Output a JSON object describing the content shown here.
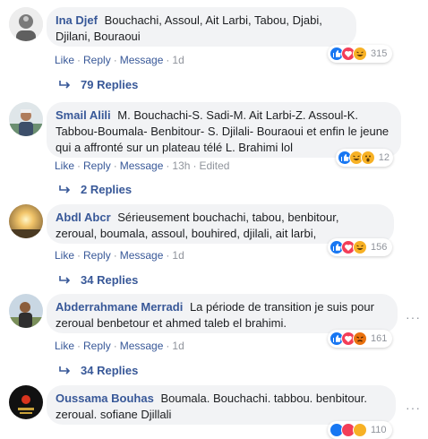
{
  "labels": {
    "like": "Like",
    "reply": "Reply",
    "message": "Message"
  },
  "comments": [
    {
      "author": "Ina Djef",
      "text": "Bouchachi, Assoul, Ait Larbi, Tabou, Djabi, Djilani, Bouraoui",
      "time": "1d",
      "edited": "",
      "reaction_count": "315",
      "reaction_icons": [
        "like-icon",
        "love-icon",
        "haha-icon"
      ],
      "replies": "79 Replies"
    },
    {
      "author": "Smail Alili",
      "text": "M. Bouchachi-S. Sadi-M. Ait Larbi-Z. Assoul-K. Tabbou-Boumala- Benbitour- S. Djilali- Bouraoui et enfin le jeune qui a affronté sur un plateau télé L. Brahimi lol",
      "time": "13h",
      "edited": "Edited",
      "reaction_count": "12",
      "reaction_icons": [
        "like-icon",
        "haha-icon",
        "wow-icon"
      ],
      "replies": "2 Replies"
    },
    {
      "author": "Abdl Abcr",
      "text": "Sérieusement bouchachi, tabou, benbitour, zeroual, boumala, assoul, bouhired, djilali, ait larbi,",
      "time": "1d",
      "edited": "",
      "reaction_count": "156",
      "reaction_icons": [
        "like-icon",
        "love-icon",
        "haha-icon"
      ],
      "replies": "34 Replies"
    },
    {
      "author": "Abderrahmane Merradi",
      "text": "La période de transition je suis pour zeroual benbetour et ahmed taleb el brahimi.",
      "time": "1d",
      "edited": "",
      "reaction_count": "161",
      "reaction_icons": [
        "like-icon",
        "love-icon",
        "angry-icon"
      ],
      "replies": "34 Replies"
    },
    {
      "author": "Oussama Bouhas",
      "text": "Boumala. Bouchachi. tabbou. benbitour. zeroual. sofiane Djillali",
      "time": "",
      "edited": "",
      "reaction_count": "110",
      "reaction_icons": [
        "like-icon",
        "love-icon",
        "haha-icon"
      ],
      "replies": ""
    }
  ],
  "more_options_label": "···",
  "colors": {
    "link": "#385898",
    "bubble": "#f2f3f5",
    "meta": "#90949c"
  }
}
